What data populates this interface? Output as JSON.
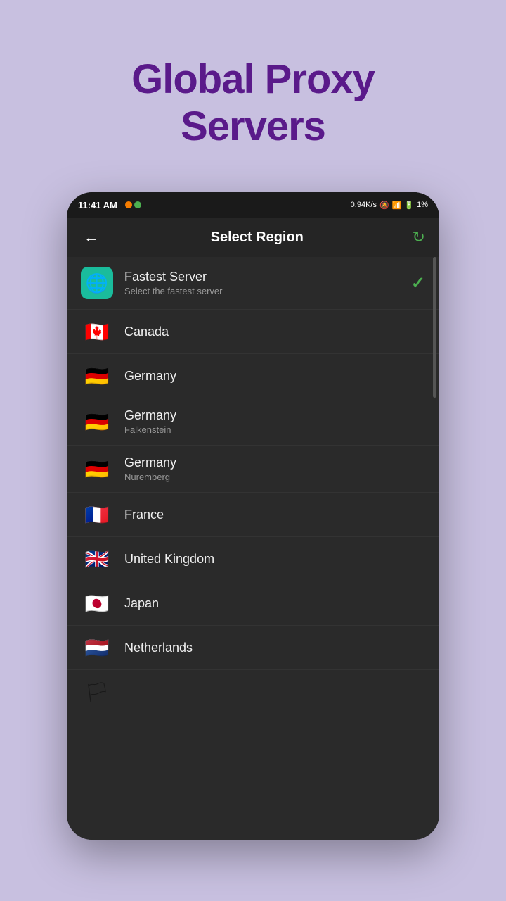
{
  "page": {
    "title_line1": "Global Proxy",
    "title_line2": "Servers",
    "background_color": "#c8c0e0",
    "title_color": "#5a1a8a"
  },
  "status_bar": {
    "time": "11:41 AM",
    "speed": "0.94K/s",
    "battery": "1%"
  },
  "toolbar": {
    "title": "Select Region",
    "back_label": "←",
    "refresh_label": "↻"
  },
  "servers": [
    {
      "id": "fastest",
      "name": "Fastest Server",
      "subtitle": "Select the fastest server",
      "flag_type": "globe",
      "selected": true
    },
    {
      "id": "canada",
      "name": "Canada",
      "subtitle": "",
      "flag_type": "canada",
      "selected": false
    },
    {
      "id": "germany1",
      "name": "Germany",
      "subtitle": "",
      "flag_type": "germany",
      "selected": false
    },
    {
      "id": "germany2",
      "name": "Germany",
      "subtitle": "Falkenstein",
      "flag_type": "germany",
      "selected": false
    },
    {
      "id": "germany3",
      "name": "Germany",
      "subtitle": "Nuremberg",
      "flag_type": "germany",
      "selected": false
    },
    {
      "id": "france",
      "name": "France",
      "subtitle": "",
      "flag_type": "france",
      "selected": false
    },
    {
      "id": "uk",
      "name": "United Kingdom",
      "subtitle": "",
      "flag_type": "uk",
      "selected": false
    },
    {
      "id": "japan",
      "name": "Japan",
      "subtitle": "",
      "flag_type": "japan",
      "selected": false
    },
    {
      "id": "netherlands",
      "name": "Netherlands",
      "subtitle": "",
      "flag_type": "netherlands",
      "selected": false
    }
  ]
}
